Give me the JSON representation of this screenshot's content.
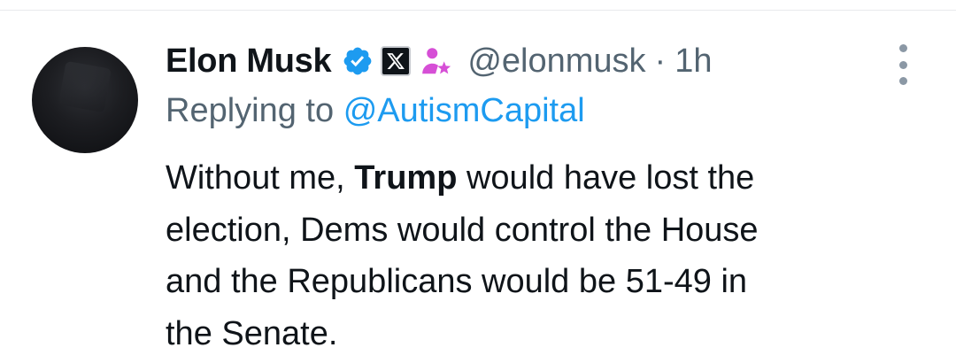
{
  "author": {
    "name": "Elon Musk",
    "handle": "@elonmusk",
    "separator": "·",
    "timestamp": "1h"
  },
  "badges": {
    "verified": "verified-check-icon",
    "affiliation": "x-logo-icon",
    "affiliate_label": "gender-icon"
  },
  "reply": {
    "prefix": "Replying to",
    "mention": "@AutismCapital"
  },
  "tweet": {
    "line1_pre": "Without me, ",
    "line1_bold": "Trump",
    "line1_post": " would have lost the",
    "line2": "election, Dems would control the House",
    "line3": "and the Republicans would be 51-49 in",
    "line4": "the Senate."
  },
  "colors": {
    "text_primary": "#0f1419",
    "text_secondary": "#536471",
    "link": "#1d9bf0",
    "verified": "#1d9bf0",
    "affiliate_icon": "#d64fd6"
  }
}
